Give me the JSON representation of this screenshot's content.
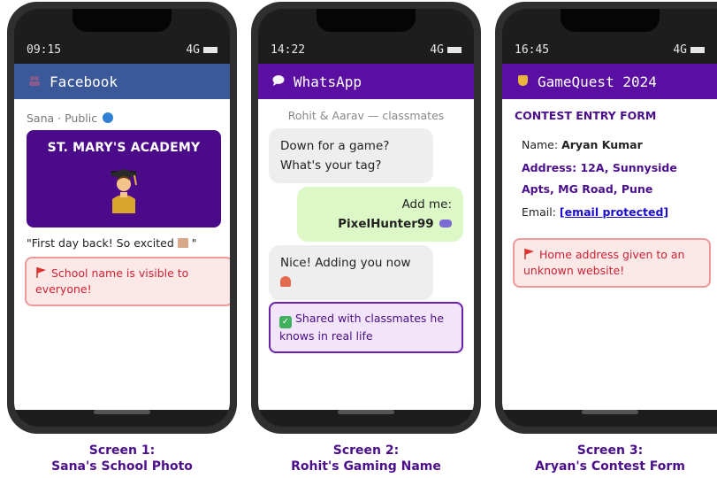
{
  "screens": [
    {
      "status": {
        "time": "09:15",
        "network": "4G"
      },
      "app": {
        "name": "Facebook",
        "color": "#3b5998"
      },
      "post": {
        "author": "Sana · Public",
        "school": "ST. MARY'S ACADEMY",
        "text": "\"First day back! So excited",
        "text_end": "\""
      },
      "alert": "School name is visible to everyone!",
      "caption": {
        "line1": "Screen 1:",
        "line2": "Sana's School Photo"
      }
    },
    {
      "status": {
        "time": "14:22",
        "network": "4G"
      },
      "app": {
        "name": "WhatsApp",
        "color": "#5b0fa2"
      },
      "chat": {
        "header": "Rohit & Aarav — classmates",
        "msg1_line1": "Down for a game?",
        "msg1_line2": "What's your tag?",
        "msg2_line1": "Add me:",
        "msg2_line2": "PixelHunter99",
        "msg3_line1": "Nice! Adding you now"
      },
      "success": "Shared with classmates he knows in real life",
      "caption": {
        "line1": "Screen 2:",
        "line2": "Rohit's Gaming Name"
      }
    },
    {
      "status": {
        "time": "16:45",
        "network": "4G"
      },
      "app": {
        "name": "GameQuest 2024",
        "color": "#5b0fa2"
      },
      "form": {
        "title": "CONTEST ENTRY FORM",
        "name_label": "Name:",
        "name_value": "Aryan Kumar",
        "address_line1": "Address: 12A, Sunnyside",
        "address_line2": "Apts, MG Road, Pune",
        "email_label": "Email:",
        "email_value": "[email protected]"
      },
      "alert": "Home address given to an unknown website!",
      "caption": {
        "line1": "Screen 3:",
        "line2": "Aryan's Contest Form"
      }
    }
  ],
  "icons": {
    "facebook": "people-icon",
    "whatsapp": "chat-bubble-icon",
    "gamequest": "trophy-icon",
    "alert": "red-flag-icon",
    "success": "check-mark-icon"
  },
  "colors": {
    "alert_bg": "#fde8e8",
    "alert_border": "#ee9a9a",
    "alert_text": "#cc2233",
    "success_bg": "#f3e5f9",
    "success_border": "#6b1fb1",
    "caption": "#4b0f8c"
  }
}
